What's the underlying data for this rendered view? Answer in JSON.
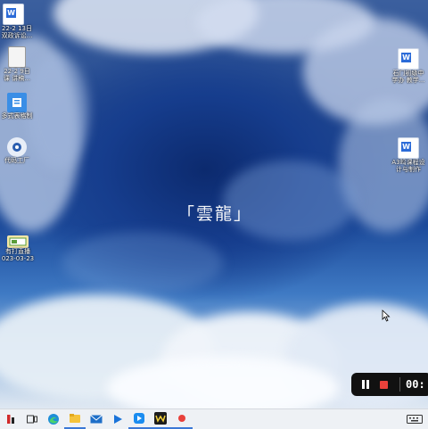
{
  "desktop": {
    "wallpaper_text": "「雲龍」",
    "icons_left": [
      {
        "label1": "",
        "label2": "",
        "type": "word"
      },
      {
        "label1": "22-2 13日",
        "label2": "双政诉讼...",
        "type": "doc"
      },
      {
        "label1": "22-2 9日",
        "label2": "课 讲稿...",
        "type": "doc"
      },
      {
        "label1": "多式表格制",
        "label2": "",
        "type": "app"
      },
      {
        "label1": "代码工厂",
        "label2": "",
        "type": "app"
      },
      {
        "label1": "有打直播",
        "label2": "023-03-23",
        "type": "app"
      }
    ],
    "icons_right": [
      {
        "label1": "石门初级中",
        "label2": "学办 教学...",
        "type": "word"
      },
      {
        "label1": "A3鸣课程设",
        "label2": "计与制作",
        "type": "word"
      }
    ]
  },
  "recorder": {
    "time": "00:",
    "pause_label": "pause",
    "stop_label": "stop"
  },
  "taskbar": {
    "items": [
      "widgets-icon",
      "task-view-icon",
      "edge-icon",
      "file-explorer-icon",
      "mail-icon",
      "media-player-icon",
      "app-icon",
      "wps-icon",
      "recorder-icon"
    ],
    "tray_label": "EN"
  },
  "colors": {
    "accent": "#3a78d6",
    "record_red": "#e8413b",
    "word_blue": "#2b6bd8"
  }
}
